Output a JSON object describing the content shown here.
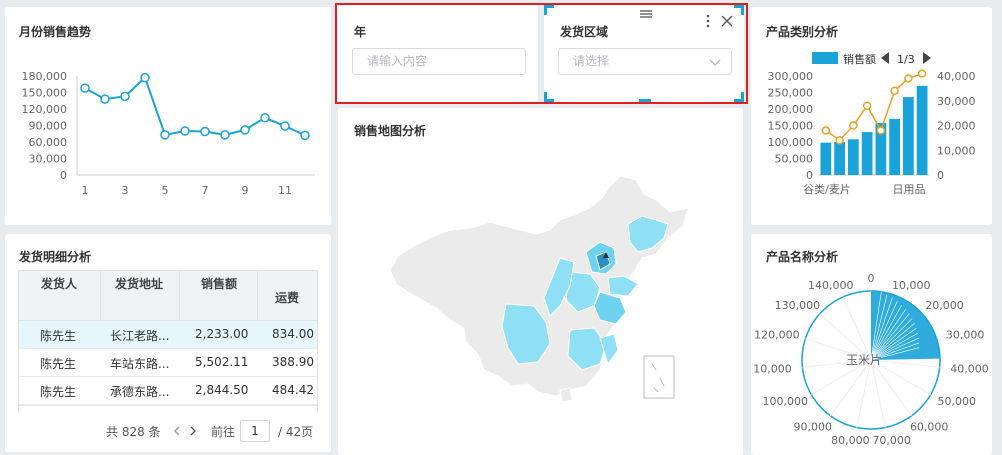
{
  "monthly_trend": {
    "title": "月份销售趋势",
    "y_ticks": [
      "180,000",
      "150,000",
      "120,000",
      "90,000",
      "60,000",
      "30,000",
      "0"
    ],
    "x_ticks": [
      "1",
      "3",
      "5",
      "7",
      "9",
      "11"
    ],
    "chart_data": {
      "type": "line",
      "x": [
        1,
        2,
        3,
        4,
        5,
        6,
        7,
        8,
        9,
        10,
        11,
        12
      ],
      "values": [
        158000,
        138000,
        143000,
        177000,
        73000,
        80000,
        79000,
        73000,
        82000,
        104000,
        89000,
        72000
      ],
      "ylim": [
        0,
        180000
      ],
      "color": "#19a3d8"
    }
  },
  "filters": {
    "year": {
      "label": "年",
      "placeholder": "请输入内容"
    },
    "region": {
      "label": "发货区域",
      "placeholder": "请选择"
    }
  },
  "map": {
    "title": "销售地图分析"
  },
  "category": {
    "title": "产品类别分析",
    "legend": "销售额",
    "pager": "1/3",
    "y_left_ticks": [
      "300,000",
      "250,000",
      "200,000",
      "150,000",
      "100,000",
      "50,000",
      "0"
    ],
    "y_right_ticks": [
      "40,000",
      "30,000",
      "20,000",
      "10,000",
      "0"
    ],
    "x_labels": [
      "谷类/麦片",
      "日用品"
    ],
    "chart_data": {
      "type": "bar",
      "bars": [
        98000,
        100000,
        108000,
        130000,
        158000,
        170000,
        236000,
        270000
      ],
      "line": [
        18000,
        14000,
        20000,
        28000,
        18000,
        34000,
        39000,
        41000
      ],
      "ylim_left": [
        0,
        300000
      ],
      "ylim_right": [
        0,
        40000
      ],
      "colors": {
        "bar": "#19a3d8",
        "line": "#f0a020"
      }
    }
  },
  "detail": {
    "title": "发货明细分析",
    "columns": [
      "发货人",
      "发货地址",
      "销售额",
      "运费"
    ],
    "rows": [
      [
        "陈先生",
        "长江老路...",
        "2,233.00",
        "834.00"
      ],
      [
        "陈先生",
        "车站东路...",
        "5,502.11",
        "388.90"
      ],
      [
        "陈先生",
        "承德东路...",
        "2,844.50",
        "484.42"
      ]
    ],
    "pager": {
      "total": "共 828 条",
      "goto": "前往",
      "page": "1",
      "pages": "/ 42页"
    }
  },
  "product_name": {
    "title": "产品名称分析",
    "center_label": "玉米片",
    "ticks": [
      "0",
      "10,000",
      "20,000",
      "30,000",
      "40,000",
      "50,000",
      "60,000",
      "70,000",
      "80,000",
      "90,000",
      "100,000",
      "10,000",
      "120,000",
      "130,000",
      "140,000"
    ],
    "chart_data": {
      "type": "pie",
      "max": 150000,
      "color": "#19a3d8"
    }
  }
}
